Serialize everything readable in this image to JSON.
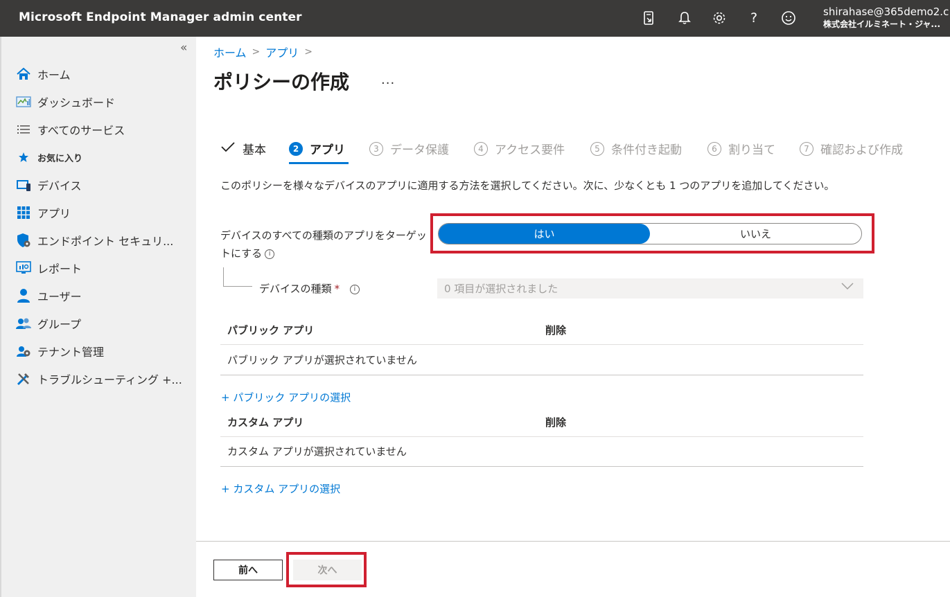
{
  "app": {
    "title": "Microsoft Endpoint Manager admin center",
    "user_email": "shirahase@365demo2.c",
    "user_org": "株式会社イルミネート・ジャ..."
  },
  "topbar_icons": [
    "feedback-tablet-icon",
    "bell-icon",
    "gear-icon",
    "help-icon",
    "smiley-icon"
  ],
  "topbar_help_glyph": "?",
  "sidebar": {
    "items": [
      {
        "label": "ホーム",
        "icon": "home-icon"
      },
      {
        "label": "ダッシュボード",
        "icon": "dashboard-icon"
      },
      {
        "label": "すべてのサービス",
        "icon": "list-icon"
      },
      {
        "label": "お気に入り",
        "icon": "star-icon"
      },
      {
        "label": "デバイス",
        "icon": "device-icon"
      },
      {
        "label": "アプリ",
        "icon": "apps-grid-icon"
      },
      {
        "label": "エンドポイント セキュリ...",
        "icon": "shield-icon"
      },
      {
        "label": "レポート",
        "icon": "report-monitor-icon"
      },
      {
        "label": "ユーザー",
        "icon": "user-icon"
      },
      {
        "label": "グループ",
        "icon": "group-icon"
      },
      {
        "label": "テナント管理",
        "icon": "tenant-admin-icon"
      },
      {
        "label": "トラブルシューティング +...",
        "icon": "tools-icon"
      }
    ],
    "collapse_glyph": "«"
  },
  "breadcrumb": {
    "home": "ホーム",
    "apps": "アプリ",
    "sep": ">"
  },
  "page": {
    "title": "ポリシーの作成",
    "more": "..."
  },
  "wizard": {
    "steps": [
      {
        "num": "",
        "label": "基本",
        "state": "done"
      },
      {
        "num": "2",
        "label": "アプリ",
        "state": "active"
      },
      {
        "num": "3",
        "label": "データ保護",
        "state": "pending"
      },
      {
        "num": "4",
        "label": "アクセス要件",
        "state": "pending"
      },
      {
        "num": "5",
        "label": "条件付き起動",
        "state": "pending"
      },
      {
        "num": "6",
        "label": "割り当て",
        "state": "pending"
      },
      {
        "num": "7",
        "label": "確認および作成",
        "state": "pending"
      }
    ]
  },
  "form": {
    "description": "このポリシーを様々なデバイスのアプリに適用する方法を選択してください。次に、少なくとも 1 つのアプリを追加してください。",
    "target_all_label": "デバイスのすべての種類のアプリをターゲットにする",
    "toggle_yes": "はい",
    "toggle_no": "いいえ",
    "toggle_selected": "はい",
    "device_type_label": "デバイスの種類",
    "required_mark": "*",
    "info_glyph": "i",
    "device_type_value": "0 項目が選択されました"
  },
  "public_apps": {
    "header_name": "パブリック アプリ",
    "header_delete": "削除",
    "empty": "パブリック アプリが選択されていません",
    "add_link": "+ パブリック アプリの選択"
  },
  "custom_apps": {
    "header_name": "カスタム アプリ",
    "header_delete": "削除",
    "empty": "カスタム アプリが選択されていません",
    "add_link": "+ カスタム アプリの選択"
  },
  "footer": {
    "prev": "前へ",
    "next": "次へ"
  },
  "colors": {
    "accent": "#0078d4",
    "topbar": "#3b3a39",
    "highlight": "#d02030"
  }
}
